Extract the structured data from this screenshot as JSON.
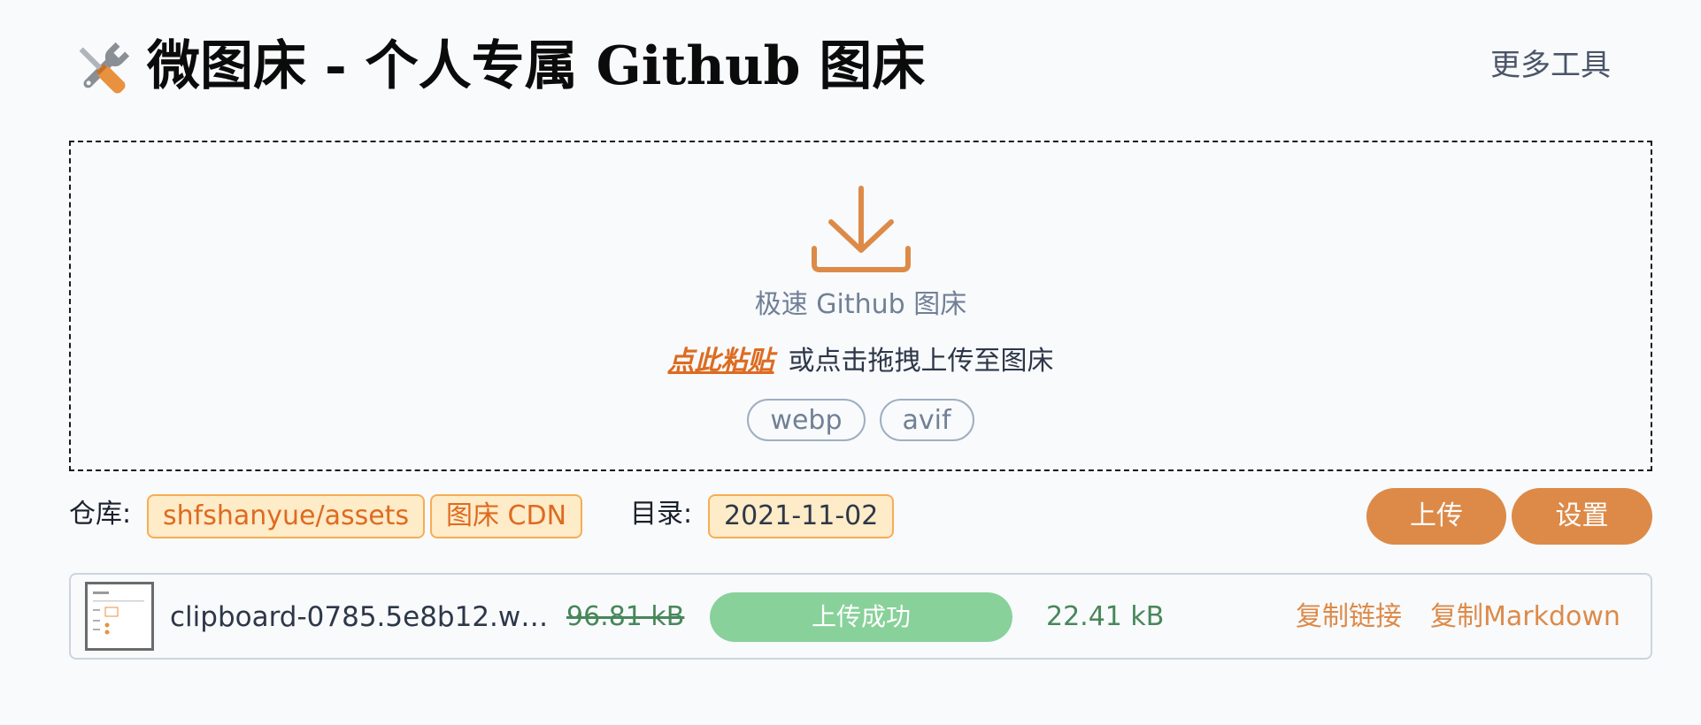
{
  "header": {
    "title": "微图床 - 个人专属 Github 图床",
    "more_tools": "更多工具",
    "logo_icon": "tools-icon"
  },
  "dropzone": {
    "icon": "download-icon",
    "title": "极速 Github 图床",
    "paste_link": "点此粘贴",
    "hint": "或点击拖拽上传至图床",
    "formats": [
      "webp",
      "avif"
    ]
  },
  "meta": {
    "repo_label": "仓库:",
    "repo_value": "shfshanyue/assets",
    "cdn_label": "图床 CDN",
    "dir_label": "目录:",
    "dir_value": "2021-11-02",
    "upload_button": "上传",
    "settings_button": "设置"
  },
  "files": [
    {
      "name": "clipboard-0785.5e8b12.we...",
      "original_size": "96.81 kB",
      "status": "上传成功",
      "progress": 1.0,
      "new_size": "22.41 kB",
      "copy_link": "复制链接",
      "copy_markdown": "复制Markdown"
    }
  ],
  "colors": {
    "accent": "#dd8a48",
    "success": "#88d19a",
    "chip_bg": "#feebc8"
  }
}
